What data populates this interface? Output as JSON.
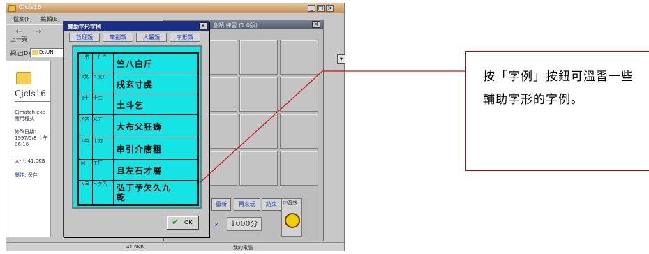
{
  "explorer": {
    "title": "Cjcls16",
    "menu": [
      "檔案(F)",
      "編輯(E)"
    ],
    "toolbar": {
      "back": "上一頁",
      "forward": "→"
    },
    "address_label": "網址(D)",
    "address_value": "D:\\UN",
    "folder_name": "Cjcls16",
    "file_name": "Cjmatch.exe",
    "file_type": "應用程式",
    "modified_label": "修改日期:",
    "modified_value": "1997/5/8 上午 06:16",
    "size": "大小: 41.0KB",
    "attr_label": "屬性:",
    "attr_value": "保存",
    "status_left": "41.0KB",
    "status_right": "我的電腦"
  },
  "game": {
    "title": "倉頡 練習 (1.0版)",
    "buttons": [
      "重新",
      "再來玩",
      "結束"
    ],
    "score": "1000分",
    "sound_label": "音效"
  },
  "dialog": {
    "title": "輔助字形字例",
    "tabs": [
      "哲理類",
      "筆劃類",
      "人體類",
      "字形類"
    ],
    "rows": [
      {
        "key": "H竹",
        "shape": "ㅡ亻⺈",
        "example": "竺八白斤"
      },
      {
        "key": "I戈",
        "shape": "丶乂广",
        "example": "戌玄寸虔"
      },
      {
        "key": "J十",
        "shape": "十土",
        "example": "土斗乞"
      },
      {
        "key": "K大",
        "shape": "乂ナ",
        "example": "大布父狂癖"
      },
      {
        "key": "L中",
        "shape": "丨刀",
        "example": "串引介唐粗"
      },
      {
        "key": "M一",
        "shape": "工厂",
        "example": "且左石才層"
      },
      {
        "key": "N弓",
        "shape": "ㄱク乙",
        "example": "弘丁予欠久九乾"
      }
    ],
    "ok_label": "OK"
  },
  "callout": {
    "text": "按「字例」按鈕可溫習一些輔助字形的字例。"
  },
  "colors": {
    "dialog_panel": "#16e4e4",
    "dialog_title": "#1a2f8a",
    "callout_border": "#c00000"
  }
}
